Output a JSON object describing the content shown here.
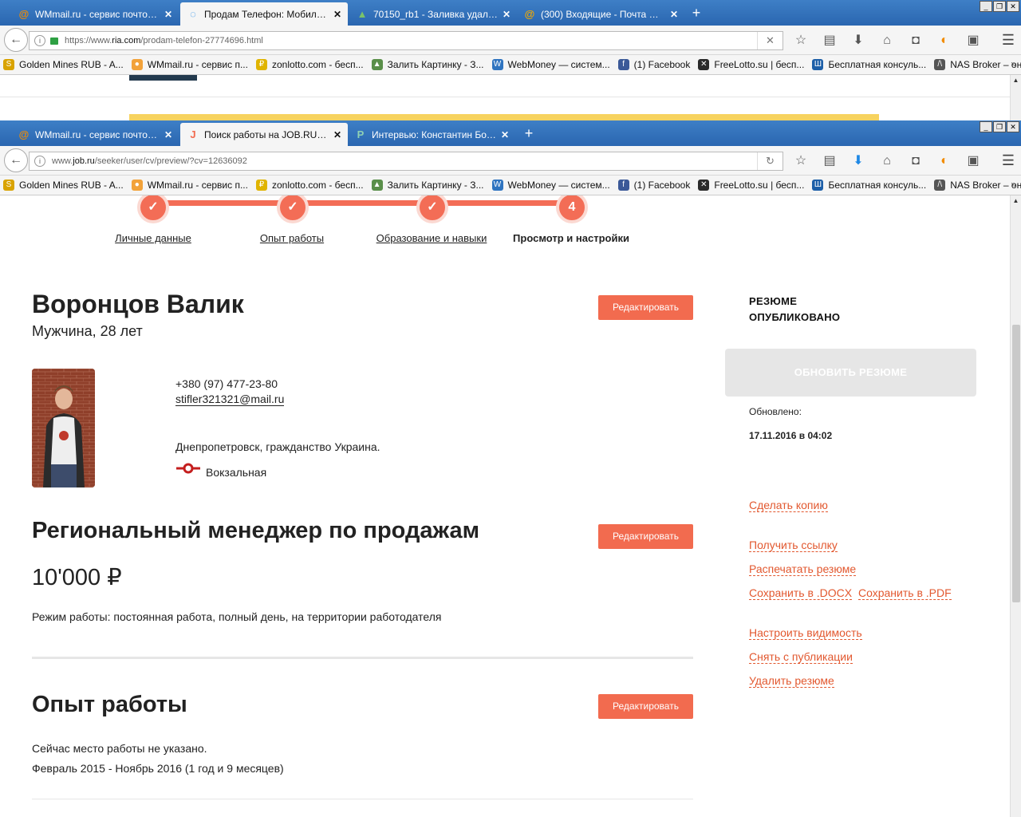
{
  "back_window": {
    "tabs": [
      {
        "label": "WMmail.ru - сервис почтовы...",
        "icon": "at-icon",
        "icon_color": "#f28c00"
      },
      {
        "label": "Продам Телефон: Мобильн...",
        "icon": "loading-icon",
        "icon_color": "#1e88e5"
      },
      {
        "label": "70150_rb1 - Заливка удалас...",
        "icon": "image-icon",
        "icon_color": "#4a8a3a"
      },
      {
        "label": "(300) Входящие - Почта Mail...",
        "icon": "at-icon",
        "icon_color": "#f2a900"
      }
    ],
    "url_prefix": "https://www.",
    "url_domain": "ria.com",
    "url_path": "/prodam-telefon-27774696.html"
  },
  "front_window": {
    "tabs": [
      {
        "label": "WMmail.ru - сервис почтовы...",
        "icon": "at-icon",
        "icon_color": "#f28c00"
      },
      {
        "label": "Поиск работы на JOB.RU. Б...",
        "icon": "job-icon",
        "icon_color": "#f26b4f"
      },
      {
        "label": "Интервью: Константин Бог...",
        "icon": "pm-icon",
        "icon_color": "#3d8c6e"
      }
    ],
    "url_prefix": "www.",
    "url_domain": "job.ru",
    "url_path": "/seeker/user/cv/preview/?cv=12636092"
  },
  "bookmarks": [
    {
      "label": "Golden Mines RUB - A...",
      "icon": "golden-mines-icon",
      "color": "#d9a300",
      "glyph": "S"
    },
    {
      "label": "WMmail.ru - сервис п...",
      "icon": "wmmail-icon",
      "color": "#f2a23a",
      "glyph": "●"
    },
    {
      "label": "zonlotto.com - бесп...",
      "icon": "zonlotto-icon",
      "color": "#e0b400",
      "glyph": "₽"
    },
    {
      "label": "Залить Картинку - З...",
      "icon": "image-upload-icon",
      "color": "#5a8f4a",
      "glyph": "▲"
    },
    {
      "label": "WebMoney — систем...",
      "icon": "webmoney-icon",
      "color": "#2f74c0",
      "glyph": "W"
    },
    {
      "label": "(1) Facebook",
      "icon": "facebook-icon",
      "color": "#3b5998",
      "glyph": "f"
    },
    {
      "label": "FreeLotto.su | бесп...",
      "icon": "freelotto-icon",
      "color": "#2a2a2a",
      "glyph": "✕"
    },
    {
      "label": "Бесплатная консуль...",
      "icon": "consult-icon",
      "color": "#1d5fa8",
      "glyph": "Ш"
    },
    {
      "label": "NAS Broker – онлайн ...",
      "icon": "nas-broker-icon",
      "color": "#555555",
      "glyph": "/\\"
    }
  ],
  "steps": [
    {
      "mark": "✓",
      "label": "Личные данные"
    },
    {
      "mark": "✓",
      "label": "Опыт работы"
    },
    {
      "mark": "✓",
      "label": "Образование и навыки"
    },
    {
      "mark": "4",
      "label": "Просмотр и настройки"
    }
  ],
  "resume": {
    "name": "Воронцов Валик",
    "gender_age": "Мужчина, 28 лет",
    "phone": "+380 (97) 477-23-80",
    "email": "stifler321321@mail.ru",
    "city": "Днепропетровск, гражданство Украина.",
    "metro": "Вокзальная",
    "position": "Региональный менеджер по продажам",
    "salary": "10'000 ₽",
    "work_mode": "Режим работы: постоянная работа, полный день, на территории работодателя",
    "experience_title": "Опыт работы",
    "experience_current": "Сейчас место работы не указано.",
    "experience_period": "Февраль 2015 - Ноябрь 2016 (1 год и 9 месяцев)",
    "edit_label": "Редактировать"
  },
  "sidebar": {
    "status_line1": "РЕЗЮМЕ",
    "status_line2": "ОПУБЛИКОВАНО",
    "refresh_label": "ОБНОВИТЬ РЕЗЮМЕ",
    "updated_label": "Обновлено:",
    "updated_date": "17.11.2016 в 04:02",
    "copy_link": "Сделать копию",
    "get_link": "Получить ссылку",
    "print_link": "Распечатать резюме",
    "save_docx": "Сохранить в .DOCX",
    "save_pdf": "Сохранить в .PDF",
    "visibility_link": "Настроить видимость",
    "unpublish_link": "Снять с публикации",
    "delete_link": "Удалить резюме"
  },
  "colors": {
    "accent": "#f26b4f",
    "link": "#e2582f",
    "tabbar": "#2a66b0"
  }
}
